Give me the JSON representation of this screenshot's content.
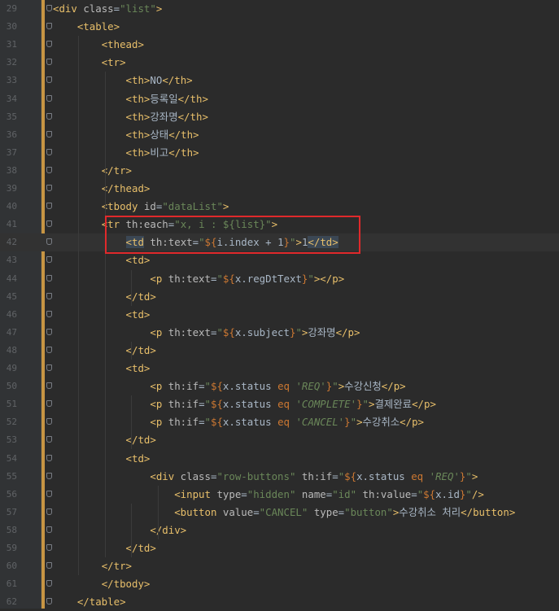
{
  "editor": {
    "lines": [
      {
        "n": "29",
        "text": "<div class=\"list\">"
      },
      {
        "n": "30",
        "text": "    <table>"
      },
      {
        "n": "31",
        "text": "        <thead>"
      },
      {
        "n": "32",
        "text": "        <tr>"
      },
      {
        "n": "33",
        "text": "            <th>NO</th>"
      },
      {
        "n": "34",
        "text": "            <th>등록일</th>"
      },
      {
        "n": "35",
        "text": "            <th>강좌명</th>"
      },
      {
        "n": "36",
        "text": "            <th>상태</th>"
      },
      {
        "n": "37",
        "text": "            <th>비고</th>"
      },
      {
        "n": "38",
        "text": "        </tr>"
      },
      {
        "n": "39",
        "text": "        </thead>"
      },
      {
        "n": "40",
        "text": "        <tbody id=\"dataList\">"
      },
      {
        "n": "41",
        "text": "        <tr th:each=\"x, i : ${list}\">"
      },
      {
        "n": "42",
        "text": "            <td th:text=\"${i.index + 1}\">1</td>"
      },
      {
        "n": "43",
        "text": "            <td>"
      },
      {
        "n": "44",
        "text": "                <p th:text=\"${x.regDtText}\"></p>"
      },
      {
        "n": "45",
        "text": "            </td>"
      },
      {
        "n": "46",
        "text": "            <td>"
      },
      {
        "n": "47",
        "text": "                <p th:text=\"${x.subject}\">강좌명</p>"
      },
      {
        "n": "48",
        "text": "            </td>"
      },
      {
        "n": "49",
        "text": "            <td>"
      },
      {
        "n": "50",
        "text": "                <p th:if=\"${x.status eq 'REQ'}\">수강신청</p>"
      },
      {
        "n": "51",
        "text": "                <p th:if=\"${x.status eq 'COMPLETE'}\">결제완료</p>"
      },
      {
        "n": "52",
        "text": "                <p th:if=\"${x.status eq 'CANCEL'}\">수강취소</p>"
      },
      {
        "n": "53",
        "text": "            </td>"
      },
      {
        "n": "54",
        "text": "            <td>"
      },
      {
        "n": "55",
        "text": "                <div class=\"row-buttons\" th:if=\"${x.status eq 'REQ'}\">"
      },
      {
        "n": "56",
        "text": "                    <input type=\"hidden\" name=\"id\" th:value=\"${x.id}\"/>"
      },
      {
        "n": "57",
        "text": "                    <button value=\"CANCEL\" type=\"button\">수강취소 처리</button>"
      },
      {
        "n": "58",
        "text": "                </div>"
      },
      {
        "n": "59",
        "text": "            </td>"
      },
      {
        "n": "60",
        "text": "        </tr>"
      },
      {
        "n": "61",
        "text": "        </tbody>"
      },
      {
        "n": "62",
        "text": "    </table>"
      }
    ],
    "current_line": "42",
    "highlight_color": "#e0292b",
    "accent_bar_color": "#c79543"
  }
}
